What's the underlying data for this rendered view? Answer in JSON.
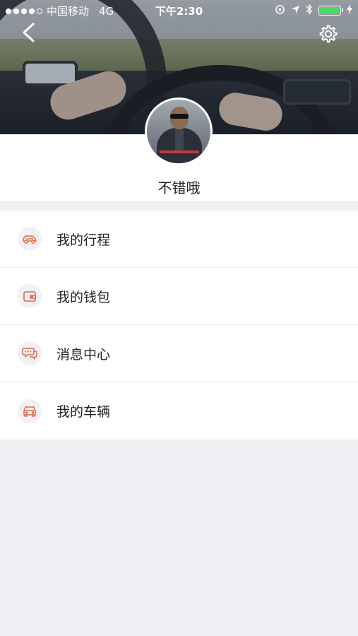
{
  "status_bar": {
    "carrier": "中国移动",
    "network": "4G",
    "time": "下午2:30",
    "battery_level_percent": 95
  },
  "nav": {
    "back_icon": "chevron-left-icon",
    "settings_icon": "gear-icon"
  },
  "profile": {
    "username": "不错哦"
  },
  "menu": {
    "items": [
      {
        "label": "我的行程",
        "icon": "car-icon"
      },
      {
        "label": "我的钱包",
        "icon": "wallet-icon"
      },
      {
        "label": "消息中心",
        "icon": "chat-icon"
      },
      {
        "label": "我的车辆",
        "icon": "vehicle-front-icon"
      }
    ]
  },
  "colors": {
    "icon_accent": "#e0684b",
    "background": "#efeff4",
    "battery_green": "#4cd964"
  }
}
